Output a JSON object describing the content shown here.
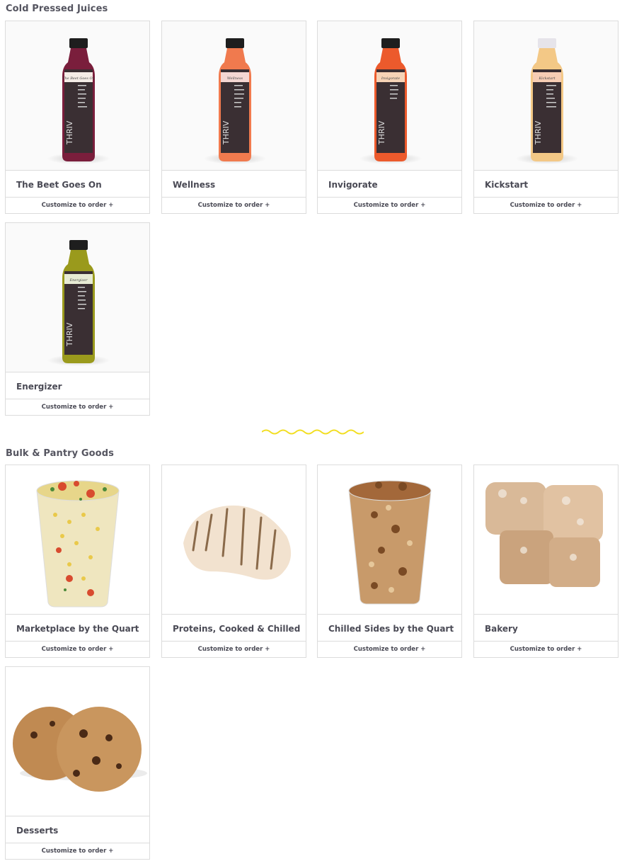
{
  "sections": [
    {
      "title": "Cold Pressed Juices",
      "items": [
        {
          "name": "The Beet Goes On",
          "cta": "Customize to order +",
          "liquid": "#7a1e3c",
          "cap": "#1e1e1e",
          "label_text": "The Beet Goes On",
          "brand": "THRIV"
        },
        {
          "name": "Wellness",
          "cta": "Customize to order +",
          "liquid": "#f07a4e",
          "cap": "#1e1e1e",
          "label_text": "Wellness",
          "brand": "THRIV"
        },
        {
          "name": "Invigorate",
          "cta": "Customize to order +",
          "liquid": "#ec5a2c",
          "cap": "#1e1e1e",
          "label_text": "Invigorate",
          "brand": "THRIV"
        },
        {
          "name": "Kickstart",
          "cta": "Customize to order +",
          "liquid": "#f3c886",
          "cap": "#e6e4ea",
          "label_text": "Kickstart",
          "brand": "THRIV"
        },
        {
          "name": "Energizer",
          "cta": "Customize to order +",
          "liquid": "#9a9a1c",
          "cap": "#1e1e1e",
          "label_text": "Energizer",
          "brand": "THRIV"
        }
      ]
    },
    {
      "title": "Bulk & Pantry Goods",
      "items": [
        {
          "name": "Marketplace by the Quart",
          "cta": "Customize to order +"
        },
        {
          "name": "Proteins, Cooked & Chilled",
          "cta": "Customize to order +"
        },
        {
          "name": "Chilled Sides by the Quart",
          "cta": "Customize to order +"
        },
        {
          "name": "Bakery",
          "cta": "Customize to order +"
        },
        {
          "name": "Desserts",
          "cta": "Customize to order +"
        }
      ]
    }
  ],
  "divider_color": "#f2de22"
}
